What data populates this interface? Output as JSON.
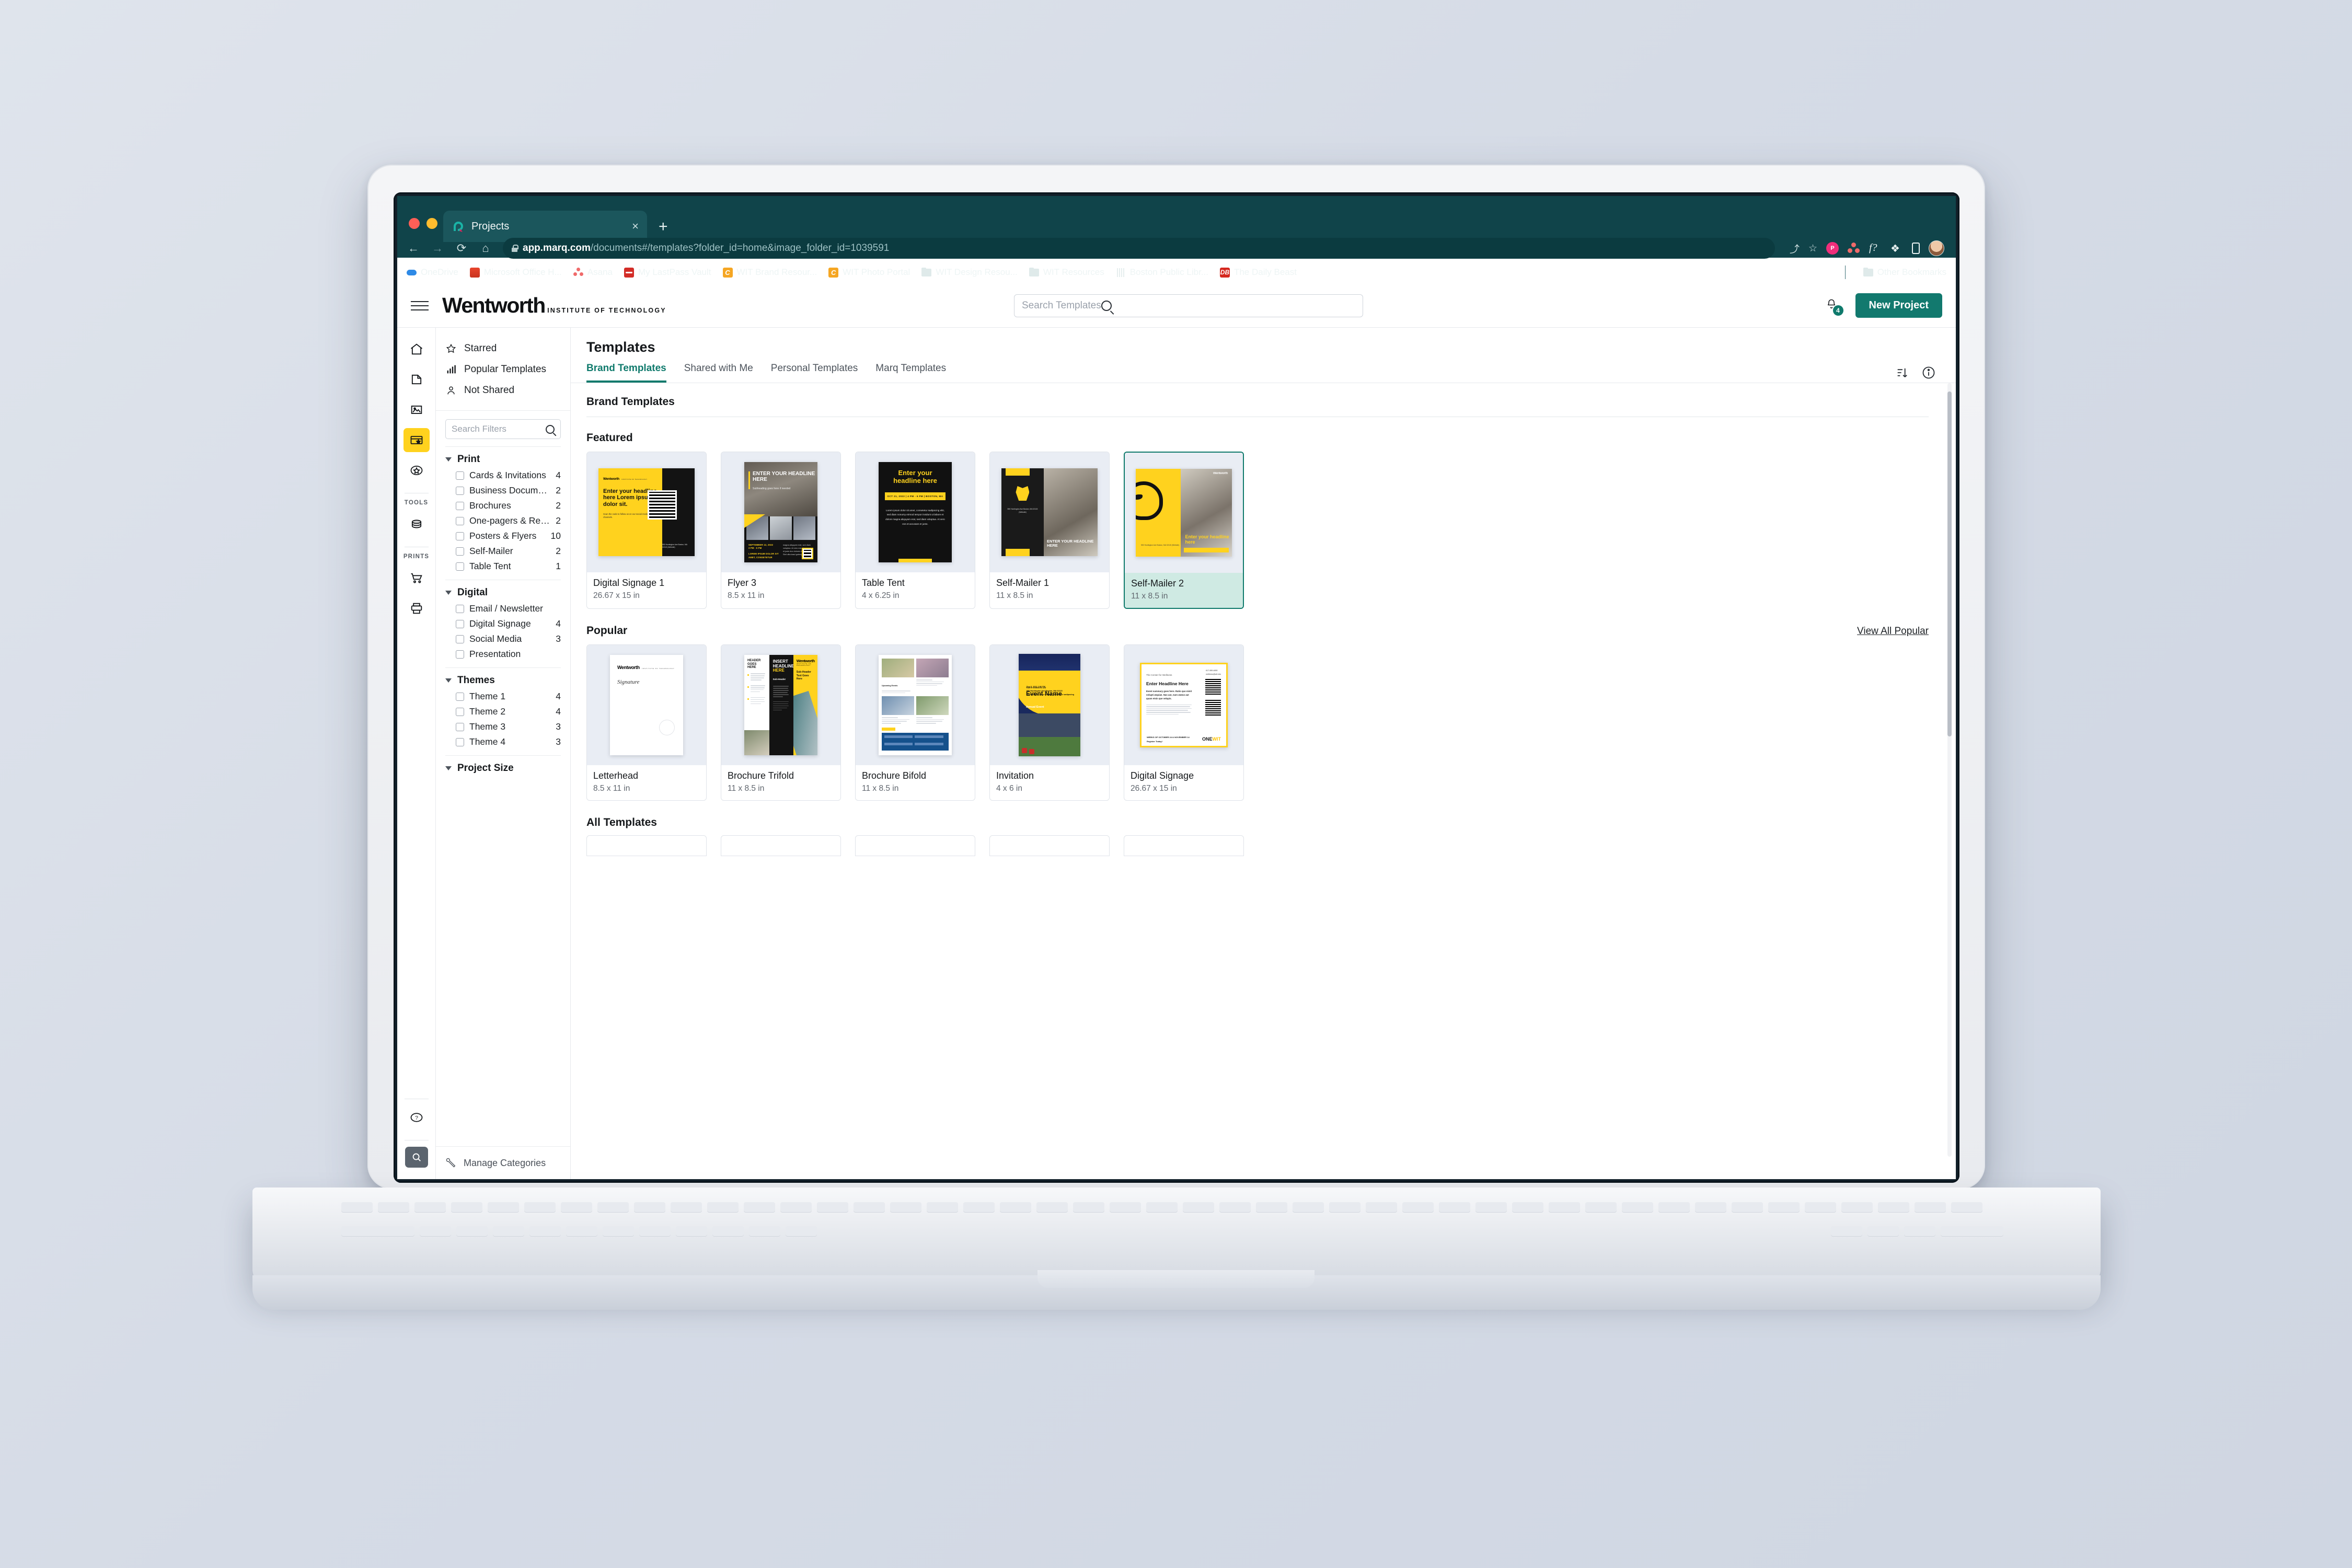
{
  "browser": {
    "tab_title": "Projects",
    "tab_close": "×",
    "new_tab": "+",
    "back": "←",
    "forward": "→",
    "reload": "⟳",
    "home": "⌂",
    "url_domain": "app.marq.com",
    "url_path": "/documents#/templates?folder_id=home&image_folder_id=1039591",
    "share_icon": "⤴",
    "star_icon": "☆",
    "ext_badge": "P",
    "ext_fq": "f?",
    "ext_puzzle": "❖",
    "bookmarks": [
      {
        "label": "OneDrive",
        "icon": "onedrive"
      },
      {
        "label": "Microsoft Office H...",
        "icon": "office"
      },
      {
        "label": "Asana",
        "icon": "asana"
      },
      {
        "label": "My LastPass Vault",
        "icon": "lastpass"
      },
      {
        "label": "WIT Brand Resour...",
        "icon": "wit"
      },
      {
        "label": "WIT Photo Portal",
        "icon": "wit"
      },
      {
        "label": "WIT Design Resou...",
        "icon": "folder"
      },
      {
        "label": "WIT Resources",
        "icon": "folder"
      },
      {
        "label": "Boston Public Libr...",
        "icon": "bpl"
      },
      {
        "label": "The Daily Beast",
        "icon": "dailybeast"
      }
    ],
    "other_bookmarks": "Other Bookmarks"
  },
  "app": {
    "logo_word": "Wentworth",
    "logo_sub": "INSTITUTE OF TECHNOLOGY",
    "search_placeholder": "Search Templates",
    "notification_count": "4",
    "new_project_label": "New Project"
  },
  "page": {
    "title": "Templates",
    "tabs": [
      {
        "label": "Brand Templates",
        "active": true
      },
      {
        "label": "Shared with Me",
        "active": false
      },
      {
        "label": "Personal Templates",
        "active": false
      },
      {
        "label": "Marq Templates",
        "active": false
      }
    ]
  },
  "rail": {
    "items": [
      {
        "name": "home-icon"
      },
      {
        "name": "document-icon"
      },
      {
        "name": "image-icon"
      },
      {
        "name": "brand-templates-icon"
      },
      {
        "name": "star-badge-icon"
      }
    ],
    "tools_label": "TOOLS",
    "prints_label": "PRINTS",
    "tools_items": [
      {
        "name": "database-icon"
      }
    ],
    "prints_items": [
      {
        "name": "cart-icon"
      },
      {
        "name": "printer-icon"
      }
    ],
    "help_icon": "?",
    "search_icon": "Q"
  },
  "filters": {
    "quick_links": [
      {
        "label": "Starred",
        "icon": "star-icon"
      },
      {
        "label": "Popular Templates",
        "icon": "bar-chart-icon"
      },
      {
        "label": "Not Shared",
        "icon": "person-icon"
      }
    ],
    "search_placeholder": "Search Filters",
    "groups": [
      {
        "name": "Print",
        "rows": [
          {
            "label": "Cards & Invitations",
            "count": "4"
          },
          {
            "label": "Business Documents",
            "count": "2"
          },
          {
            "label": "Brochures",
            "count": "2"
          },
          {
            "label": "One-pagers & Repo...",
            "count": "2"
          },
          {
            "label": "Posters & Flyers",
            "count": "10"
          },
          {
            "label": "Self-Mailer",
            "count": "2"
          },
          {
            "label": "Table Tent",
            "count": "1"
          }
        ]
      },
      {
        "name": "Digital",
        "rows": [
          {
            "label": "Email / Newsletter",
            "count": ""
          },
          {
            "label": "Digital Signage",
            "count": "4"
          },
          {
            "label": "Social Media",
            "count": "3"
          },
          {
            "label": "Presentation",
            "count": ""
          }
        ]
      },
      {
        "name": "Themes",
        "rows": [
          {
            "label": "Theme 1",
            "count": "4"
          },
          {
            "label": "Theme 2",
            "count": "4"
          },
          {
            "label": "Theme 3",
            "count": "3"
          },
          {
            "label": "Theme 4",
            "count": "3"
          }
        ]
      },
      {
        "name": "Project Size",
        "rows": []
      }
    ],
    "manage_categories": "Manage Categories"
  },
  "main": {
    "heading": "Brand Templates",
    "featured_label": "Featured",
    "popular_label": "Popular",
    "view_all_popular": "View All Popular",
    "all_templates_label": "All Templates",
    "featured": [
      {
        "name": "Digital Signage 1",
        "size": "26.67 x 15 in",
        "art": "ds1",
        "selected": false
      },
      {
        "name": "Flyer 3",
        "size": "8.5 x 11 in",
        "art": "fl3",
        "selected": false
      },
      {
        "name": "Table Tent",
        "size": "4 x 6.25 in",
        "art": "tt",
        "selected": false
      },
      {
        "name": "Self-Mailer 1",
        "size": "11 x 8.5 in",
        "art": "sm1",
        "selected": false
      },
      {
        "name": "Self-Mailer 2",
        "size": "11 x 8.5 in",
        "art": "sm2",
        "selected": true
      }
    ],
    "popular": [
      {
        "name": "Letterhead",
        "size": "8.5 x 11 in",
        "art": "lh"
      },
      {
        "name": "Brochure Trifold",
        "size": "11 x 8.5 in",
        "art": "btf"
      },
      {
        "name": "Brochure Bifold",
        "size": "11 x 8.5 in",
        "art": "bbf"
      },
      {
        "name": "Invitation",
        "size": "4 x 6 in",
        "art": "inv"
      },
      {
        "name": "Digital Signage",
        "size": "26.67 x 15 in",
        "art": "dsg"
      }
    ]
  },
  "thumbnail_text": {
    "ds1_logo": "Wentworth",
    "ds1_logo_sub": "INSTITUTE OF TECHNOLOGY",
    "ds1_headline": "Enter your headline here Lorem ipsum dolor sit.",
    "ds1_body": "Scan the code to follow us on our social media channels.",
    "ds1_addr": "550 Huntington Ave\nBoston, MA 02115\n(Website)",
    "fl3_headline": "ENTER YOUR HEADLINE HERE",
    "fl3_sub": "Subheading goes here if needed",
    "fl3_date": "SEPTEMBER 12, 2022",
    "fl3_time": "3 PM - 6 PM",
    "fl3_place": "LOREM IPSUM DOLOR SIT AMET, CONSETETUR",
    "tt_headline": "Enter your headline here",
    "tt_band": "OCT 21, 2022  |  4 PM - 6 PM  |  BOSTON, MA",
    "tt_body": "Lorem ipsum dolor sit amet, consetetur sadipscing elitr, sed diam nonumy eirmod tempor invidunt ut labore et dolore magna aliquyam erat, sed diam voluptua. At vero eos et accusam et justo.",
    "sm1_headline": "ENTER YOUR HEADLINE HERE",
    "sm2_headline": "Enter your headline here",
    "sm2_caption": "Your tagline goes here if needed",
    "lh_logo": "Wentworth",
    "lh_logo_sub": "INSTITUTE OF TECHNOLOGY",
    "btf_header": "HEADER GOES HERE",
    "btf_insert": "INSERT HEADLINE",
    "btf_here": "HERE",
    "btf_subheader": "Sub-Header",
    "btf_logo": "Wentworth",
    "btf_logo_sub": "INSTITUTE OF TECHNOLOGY",
    "btf_subtext": "Sub-Header Text Goes Here",
    "bbf_cap1": "Upcoming Events",
    "bbf_contact": "Contact Us",
    "inv_invite": "You're invited to our",
    "inv_event": "Event Name",
    "inv_annual": "Annual Event",
    "inv_date": "Sep 5, 2022 2:56 PM",
    "inv_addr": "550 Huntington Ave\nBoston, MA 02115",
    "inv_note": "Lorem ipsum dolor sit amet consetetur sadipscing",
    "dsg_kicker": "The Center for Wellness",
    "dsg_headline": "Enter Headline Here",
    "dsg_summary": "Event summary goes here. Ratio quo minit volupti atquiae. Nus aut, num utatus aut quam etsin que velupis.",
    "dsg_phone": "617-989-4890",
    "dsg_email": "wellness@wit.edu",
    "dsg_weeks": "WEEKS OF OCTOBER 24 & NOVEMBER 14",
    "dsg_register": "Register Today!",
    "dsg_one": "ONE",
    "dsg_wit": "WIT",
    "dsg_onesub": "CONNECT · SUPPORT · THRIVE"
  },
  "colors": {
    "brand_teal": "#12796e",
    "brand_yellow": "#ffd21e",
    "chrome_teal": "#10444a",
    "selected_bg": "#cfeae3"
  }
}
